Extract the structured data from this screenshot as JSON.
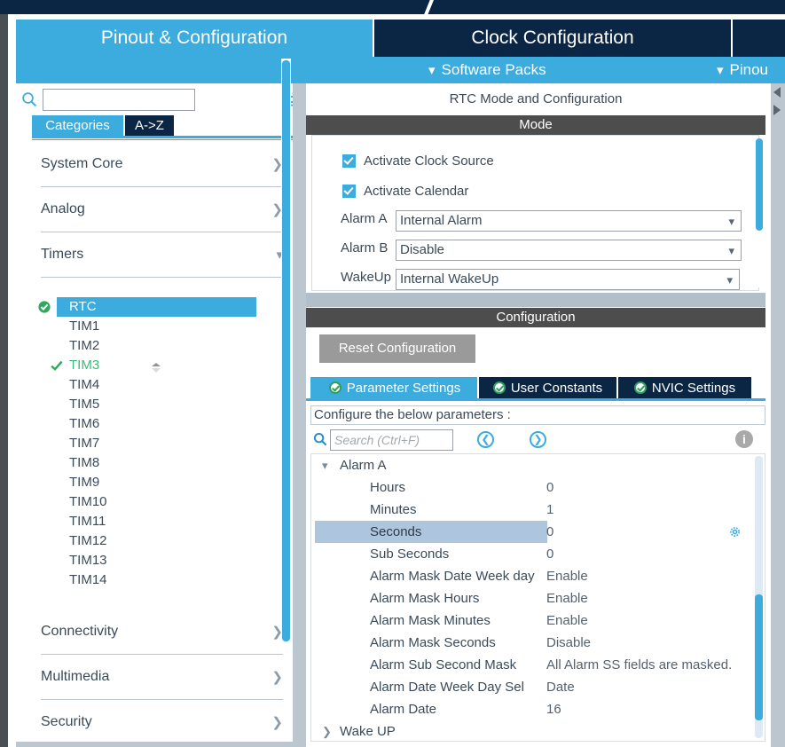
{
  "app": {
    "main_tabs": [
      {
        "label": "Pinout & Configuration",
        "active": true
      },
      {
        "label": "Clock Configuration",
        "active": false
      },
      {
        "label": "",
        "active": false
      }
    ],
    "sub_bar": [
      {
        "label": "Software Packs",
        "icon": "chevron-down-icon"
      },
      {
        "label": "Pinou",
        "icon": "chevron-down-icon"
      }
    ],
    "accent_color": "#3cabdd",
    "dark_color": "#0b2545",
    "header_gray": "#4d4d4d"
  },
  "sidebar": {
    "search": {
      "value": "",
      "placeholder": ""
    },
    "gear_icon": "gear-icon",
    "tabs": [
      {
        "label": "Categories",
        "active": true
      },
      {
        "label": "A->Z",
        "active": false
      }
    ],
    "categories": [
      {
        "label": "System Core",
        "state": "collapsed"
      },
      {
        "label": "Analog",
        "state": "collapsed"
      },
      {
        "label": "Timers",
        "state": "expanded"
      }
    ],
    "timers": [
      {
        "label": "RTC",
        "selected": true,
        "configured": true
      },
      {
        "label": "TIM1",
        "selected": false,
        "configured": false
      },
      {
        "label": "TIM2",
        "selected": false,
        "configured": false
      },
      {
        "label": "TIM3",
        "selected": false,
        "configured": true
      },
      {
        "label": "TIM4",
        "selected": false,
        "configured": false
      },
      {
        "label": "TIM5",
        "selected": false,
        "configured": false
      },
      {
        "label": "TIM6",
        "selected": false,
        "configured": false
      },
      {
        "label": "TIM7",
        "selected": false,
        "configured": false
      },
      {
        "label": "TIM8",
        "selected": false,
        "configured": false
      },
      {
        "label": "TIM9",
        "selected": false,
        "configured": false
      },
      {
        "label": "TIM10",
        "selected": false,
        "configured": false
      },
      {
        "label": "TIM11",
        "selected": false,
        "configured": false
      },
      {
        "label": "TIM12",
        "selected": false,
        "configured": false
      },
      {
        "label": "TIM13",
        "selected": false,
        "configured": false
      },
      {
        "label": "TIM14",
        "selected": false,
        "configured": false
      }
    ],
    "categories_bottom": [
      {
        "label": "Connectivity",
        "state": "collapsed"
      },
      {
        "label": "Multimedia",
        "state": "collapsed"
      },
      {
        "label": "Security",
        "state": "collapsed"
      }
    ]
  },
  "right": {
    "title": "RTC Mode and Configuration",
    "mode_header": "Mode",
    "config_header": "Configuration",
    "mode": {
      "checkboxes": [
        {
          "label": "Activate Clock Source",
          "checked": true
        },
        {
          "label": "Activate Calendar",
          "checked": true
        }
      ],
      "selects": [
        {
          "label": "Alarm A",
          "value": "Internal Alarm"
        },
        {
          "label": "Alarm B",
          "value": "Disable"
        },
        {
          "label": "WakeUp",
          "value": "Internal WakeUp"
        }
      ]
    },
    "reset_button": "Reset Configuration",
    "config_tabs": [
      {
        "label": "Parameter Settings",
        "active": true
      },
      {
        "label": "User Constants",
        "active": false
      },
      {
        "label": "NVIC Settings",
        "active": false
      }
    ],
    "configure_label": "Configure the below parameters :",
    "param_search": {
      "value": "",
      "placeholder": "Search (Ctrl+F)"
    },
    "nav_prev_icon": "chevron-left-circle-icon",
    "nav_next_icon": "chevron-right-circle-icon",
    "info_icon": "info-icon",
    "tree": {
      "group_label": "Alarm A",
      "rows": [
        {
          "name": "Hours",
          "value": "0",
          "selected": false,
          "gear": false
        },
        {
          "name": "Minutes",
          "value": "1",
          "selected": false,
          "gear": false
        },
        {
          "name": "Seconds",
          "value": "0",
          "selected": true,
          "gear": true
        },
        {
          "name": "Sub Seconds",
          "value": "0",
          "selected": false,
          "gear": false
        },
        {
          "name": "Alarm Mask Date Week day",
          "value": "Enable",
          "selected": false,
          "gear": false
        },
        {
          "name": "Alarm Mask Hours",
          "value": "Enable",
          "selected": false,
          "gear": false
        },
        {
          "name": "Alarm Mask Minutes",
          "value": "Enable",
          "selected": false,
          "gear": false
        },
        {
          "name": "Alarm Mask Seconds",
          "value": "Disable",
          "selected": false,
          "gear": false
        },
        {
          "name": "Alarm Sub Second Mask",
          "value": "All Alarm SS fields are masked.",
          "selected": false,
          "gear": false
        },
        {
          "name": "Alarm Date Week Day Sel",
          "value": "Date",
          "selected": false,
          "gear": false
        },
        {
          "name": "Alarm Date",
          "value": "16",
          "selected": false,
          "gear": false
        }
      ],
      "next_group_label": "Wake UP"
    }
  }
}
